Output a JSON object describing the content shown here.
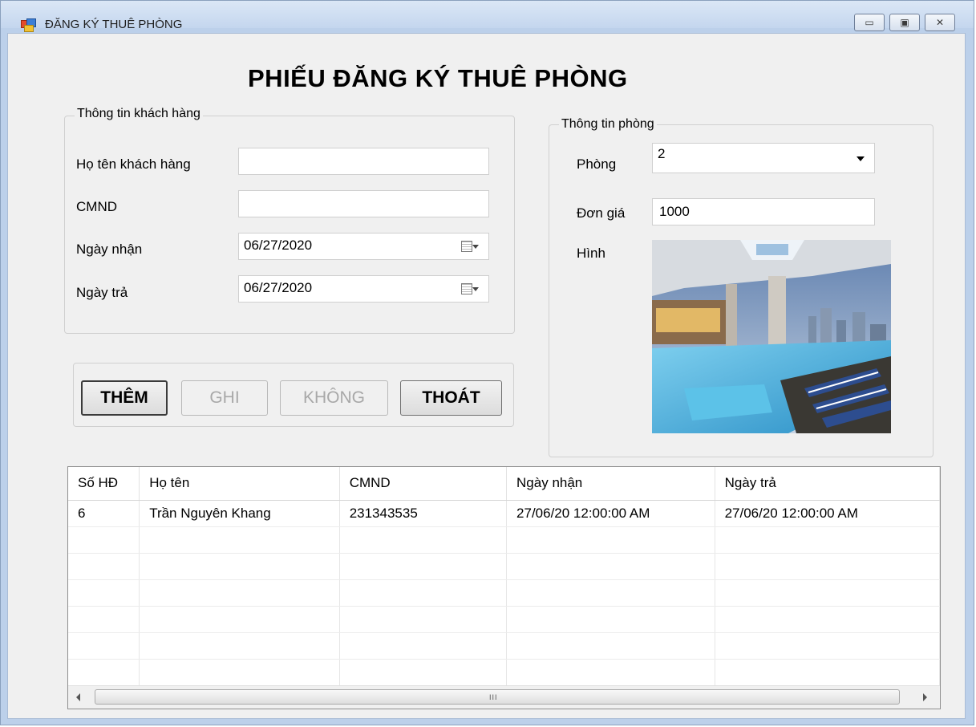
{
  "window": {
    "title": "ĐĂNG KÝ THUÊ PHÒNG",
    "minimize": "▭",
    "maximize": "▣",
    "close": "✕"
  },
  "form": {
    "title": "PHIẾU ĐĂNG KÝ THUÊ PHÒNG"
  },
  "customer": {
    "group_label": "Thông tin khách hàng",
    "name_label": "Họ tên khách hàng",
    "name_value": "",
    "id_label": "CMND",
    "id_value": "",
    "checkin_label": "Ngày nhận",
    "checkin_value": "06/27/2020",
    "checkout_label": "Ngày trả",
    "checkout_value": "06/27/2020"
  },
  "actions": {
    "add": "THÊM",
    "save": "GHI",
    "cancel": "KHÔNG",
    "exit": "THOÁT"
  },
  "room": {
    "group_label": "Thông tin phòng",
    "room_label": "Phòng",
    "room_value": "2",
    "price_label": "Đơn giá",
    "price_value": "1000",
    "image_label": "Hình"
  },
  "grid": {
    "columns": [
      "Số HĐ",
      "Họ tên",
      "CMND",
      "Ngày nhận",
      "Ngày trả"
    ],
    "rows": [
      [
        "6",
        "Trần Nguyên Khang",
        "231343535",
        "27/06/20 12:00:00 AM",
        "27/06/20 12:00:00 AM"
      ]
    ],
    "scroll_grip": "III"
  },
  "colors": {
    "pool_water": "#3fa9d6",
    "window_frame": "#bcd0ea",
    "client_bg": "#f0f0f0"
  },
  "icons": {
    "app": "app-icon",
    "calendar": "calendar-dropdown-icon",
    "combo": "chevron-down-icon"
  }
}
